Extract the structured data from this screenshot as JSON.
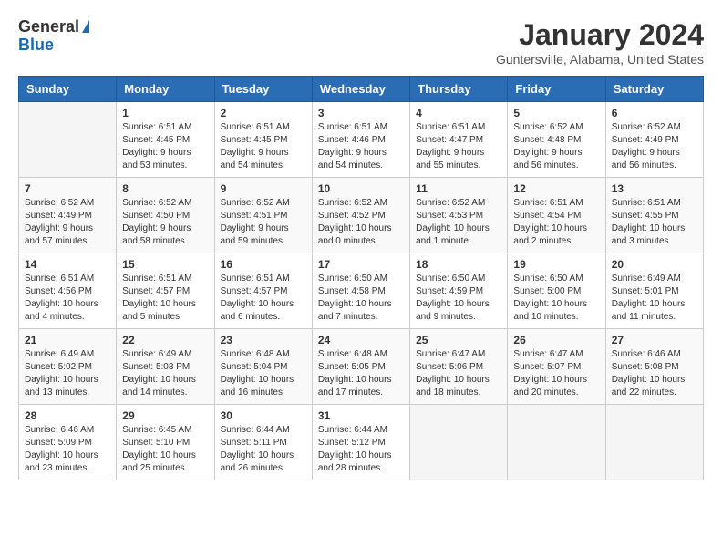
{
  "logo": {
    "general": "General",
    "blue": "Blue"
  },
  "title": "January 2024",
  "subtitle": "Guntersville, Alabama, United States",
  "days_of_week": [
    "Sunday",
    "Monday",
    "Tuesday",
    "Wednesday",
    "Thursday",
    "Friday",
    "Saturday"
  ],
  "weeks": [
    [
      {
        "day": "",
        "info": ""
      },
      {
        "day": "1",
        "info": "Sunrise: 6:51 AM\nSunset: 4:45 PM\nDaylight: 9 hours\nand 53 minutes."
      },
      {
        "day": "2",
        "info": "Sunrise: 6:51 AM\nSunset: 4:45 PM\nDaylight: 9 hours\nand 54 minutes."
      },
      {
        "day": "3",
        "info": "Sunrise: 6:51 AM\nSunset: 4:46 PM\nDaylight: 9 hours\nand 54 minutes."
      },
      {
        "day": "4",
        "info": "Sunrise: 6:51 AM\nSunset: 4:47 PM\nDaylight: 9 hours\nand 55 minutes."
      },
      {
        "day": "5",
        "info": "Sunrise: 6:52 AM\nSunset: 4:48 PM\nDaylight: 9 hours\nand 56 minutes."
      },
      {
        "day": "6",
        "info": "Sunrise: 6:52 AM\nSunset: 4:49 PM\nDaylight: 9 hours\nand 56 minutes."
      }
    ],
    [
      {
        "day": "7",
        "info": "Sunrise: 6:52 AM\nSunset: 4:49 PM\nDaylight: 9 hours\nand 57 minutes."
      },
      {
        "day": "8",
        "info": "Sunrise: 6:52 AM\nSunset: 4:50 PM\nDaylight: 9 hours\nand 58 minutes."
      },
      {
        "day": "9",
        "info": "Sunrise: 6:52 AM\nSunset: 4:51 PM\nDaylight: 9 hours\nand 59 minutes."
      },
      {
        "day": "10",
        "info": "Sunrise: 6:52 AM\nSunset: 4:52 PM\nDaylight: 10 hours\nand 0 minutes."
      },
      {
        "day": "11",
        "info": "Sunrise: 6:52 AM\nSunset: 4:53 PM\nDaylight: 10 hours\nand 1 minute."
      },
      {
        "day": "12",
        "info": "Sunrise: 6:51 AM\nSunset: 4:54 PM\nDaylight: 10 hours\nand 2 minutes."
      },
      {
        "day": "13",
        "info": "Sunrise: 6:51 AM\nSunset: 4:55 PM\nDaylight: 10 hours\nand 3 minutes."
      }
    ],
    [
      {
        "day": "14",
        "info": "Sunrise: 6:51 AM\nSunset: 4:56 PM\nDaylight: 10 hours\nand 4 minutes."
      },
      {
        "day": "15",
        "info": "Sunrise: 6:51 AM\nSunset: 4:57 PM\nDaylight: 10 hours\nand 5 minutes."
      },
      {
        "day": "16",
        "info": "Sunrise: 6:51 AM\nSunset: 4:57 PM\nDaylight: 10 hours\nand 6 minutes."
      },
      {
        "day": "17",
        "info": "Sunrise: 6:50 AM\nSunset: 4:58 PM\nDaylight: 10 hours\nand 7 minutes."
      },
      {
        "day": "18",
        "info": "Sunrise: 6:50 AM\nSunset: 4:59 PM\nDaylight: 10 hours\nand 9 minutes."
      },
      {
        "day": "19",
        "info": "Sunrise: 6:50 AM\nSunset: 5:00 PM\nDaylight: 10 hours\nand 10 minutes."
      },
      {
        "day": "20",
        "info": "Sunrise: 6:49 AM\nSunset: 5:01 PM\nDaylight: 10 hours\nand 11 minutes."
      }
    ],
    [
      {
        "day": "21",
        "info": "Sunrise: 6:49 AM\nSunset: 5:02 PM\nDaylight: 10 hours\nand 13 minutes."
      },
      {
        "day": "22",
        "info": "Sunrise: 6:49 AM\nSunset: 5:03 PM\nDaylight: 10 hours\nand 14 minutes."
      },
      {
        "day": "23",
        "info": "Sunrise: 6:48 AM\nSunset: 5:04 PM\nDaylight: 10 hours\nand 16 minutes."
      },
      {
        "day": "24",
        "info": "Sunrise: 6:48 AM\nSunset: 5:05 PM\nDaylight: 10 hours\nand 17 minutes."
      },
      {
        "day": "25",
        "info": "Sunrise: 6:47 AM\nSunset: 5:06 PM\nDaylight: 10 hours\nand 18 minutes."
      },
      {
        "day": "26",
        "info": "Sunrise: 6:47 AM\nSunset: 5:07 PM\nDaylight: 10 hours\nand 20 minutes."
      },
      {
        "day": "27",
        "info": "Sunrise: 6:46 AM\nSunset: 5:08 PM\nDaylight: 10 hours\nand 22 minutes."
      }
    ],
    [
      {
        "day": "28",
        "info": "Sunrise: 6:46 AM\nSunset: 5:09 PM\nDaylight: 10 hours\nand 23 minutes."
      },
      {
        "day": "29",
        "info": "Sunrise: 6:45 AM\nSunset: 5:10 PM\nDaylight: 10 hours\nand 25 minutes."
      },
      {
        "day": "30",
        "info": "Sunrise: 6:44 AM\nSunset: 5:11 PM\nDaylight: 10 hours\nand 26 minutes."
      },
      {
        "day": "31",
        "info": "Sunrise: 6:44 AM\nSunset: 5:12 PM\nDaylight: 10 hours\nand 28 minutes."
      },
      {
        "day": "",
        "info": ""
      },
      {
        "day": "",
        "info": ""
      },
      {
        "day": "",
        "info": ""
      }
    ]
  ]
}
